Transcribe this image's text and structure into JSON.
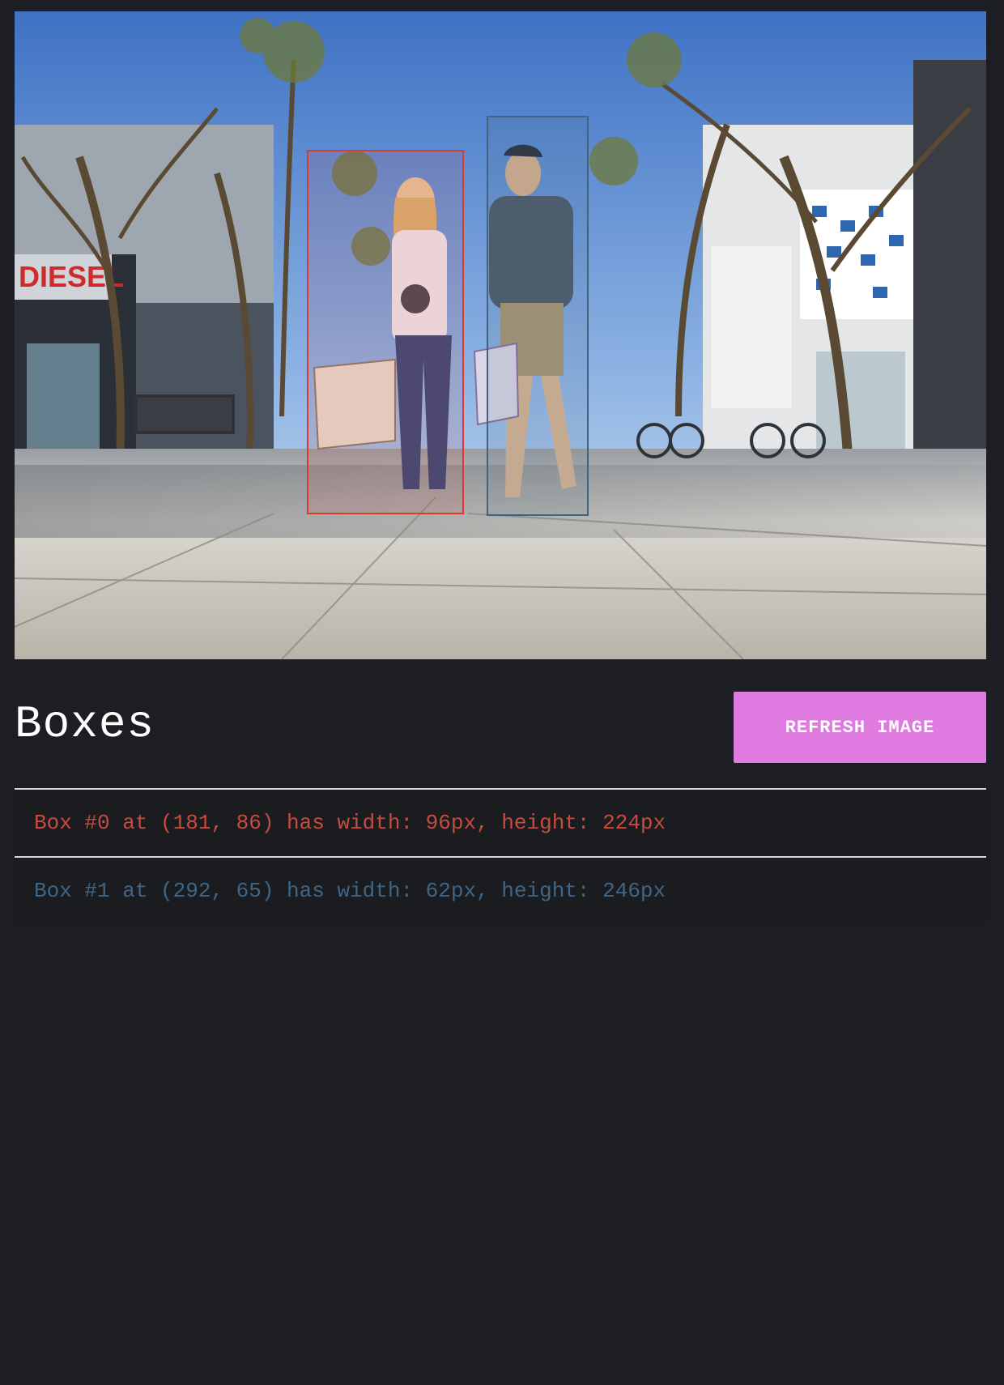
{
  "image": {
    "description_icon": "street-photo",
    "boxes": [
      {
        "id": 0,
        "color": "#d43c35"
      },
      {
        "id": 1,
        "color": "#41637f"
      }
    ]
  },
  "header": {
    "title": "Boxes",
    "refresh_label": "REFRESH IMAGE"
  },
  "box_list": [
    {
      "text": "Box #0 at (181, 86) has width: 96px, height: 224px"
    },
    {
      "text": "Box #1 at (292, 65) has width: 62px, height: 246px"
    }
  ],
  "colors": {
    "background": "#1c1e23",
    "accent": "#df7ae0",
    "box0": "#d43c35",
    "box1": "#41637f"
  }
}
